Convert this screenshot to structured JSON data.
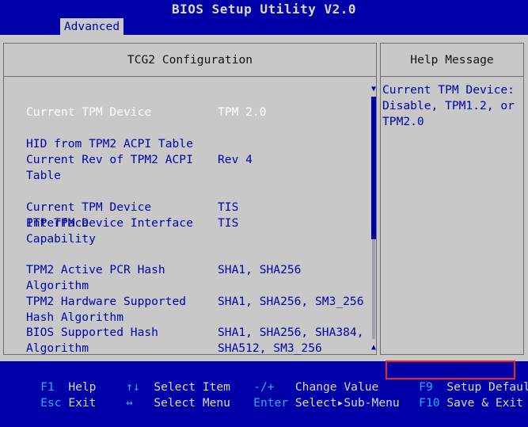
{
  "app": {
    "title": "BIOS Setup Utility V2.0"
  },
  "tabs": [
    {
      "label": "Advanced"
    }
  ],
  "main": {
    "header": "TCG2 Configuration",
    "rows": [
      {
        "label": "Current TPM Device",
        "value": "TPM 2.0",
        "selected": true
      },
      {
        "label": "HID from TPM2 ACPI Table",
        "value": ""
      },
      {
        "label": "Current Rev of TPM2 ACPI\nTable",
        "value": "Rev 4"
      },
      {
        "label": "Current TPM Device Interface",
        "value": "TIS"
      },
      {
        "label": "PTP TPM Device Interface\nCapability",
        "value": "TIS"
      },
      {
        "label": "TPM2 Active PCR Hash\nAlgorithm",
        "value": "SHA1, SHA256"
      },
      {
        "label": "TPM2 Hardware Supported\nHash Algorithm",
        "value": "SHA1, SHA256, SM3_256"
      },
      {
        "label": "BIOS Supported Hash\nAlgorithm",
        "value": "SHA1, SHA256, SHA384,\nSHA512, SM3_256"
      }
    ]
  },
  "help": {
    "header": "Help Message",
    "text": "Current TPM Device:\nDisable, TPM1.2, or\nTPM2.0"
  },
  "scroll": {
    "up_icon": "▼",
    "down_icon": "▲"
  },
  "footer": {
    "keys": [
      {
        "key": "F1",
        "desc": "Help"
      },
      {
        "key": "Esc",
        "desc": "Exit"
      },
      {
        "key": "↑↓",
        "desc": "Select Item"
      },
      {
        "key": "↔",
        "desc": "Select Menu"
      },
      {
        "key": "-/+",
        "desc": "Change Value"
      },
      {
        "key": "Enter",
        "desc": "Select▸Sub-Menu"
      },
      {
        "key": "F9",
        "desc": "Setup Defaults"
      },
      {
        "key": "F10",
        "desc": "Save & Exit"
      }
    ]
  },
  "colors": {
    "background": "#0000a8",
    "panel": "#c8c8c8",
    "selected_text": "#ffffff",
    "key_text": "#1fb0ff",
    "highlight_box": "#ff2020"
  }
}
